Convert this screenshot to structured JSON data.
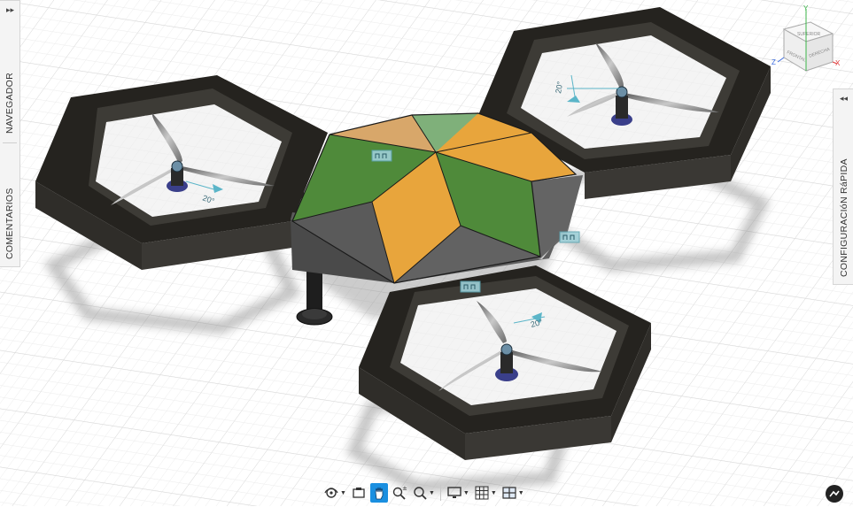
{
  "panels": {
    "navegador": "NAVEGADOR",
    "comentarios": "COMENTARIOS",
    "configuracion": "CONFIGURACIóN RáPIDA"
  },
  "viewcube": {
    "top": "SUPERIOR",
    "front": "FRONTAL",
    "right": "DERECHA",
    "axis_x": "X",
    "axis_y": "Y",
    "axis_z": "Z"
  },
  "dimensions": {
    "arm_right": "20°",
    "arm_left": "20°",
    "arm_front": "20°"
  },
  "toolbar": {
    "orbit_icon": "orbit-icon",
    "look_icon": "look-at-icon",
    "pan_icon": "pan-icon",
    "zoom_icon": "zoom-icon",
    "fit_icon": "fit-icon",
    "display_icon": "display-settings-icon",
    "grid_icon": "grid-icon",
    "viewports_icon": "viewports-icon"
  },
  "colors": {
    "frame": "#2e2c28",
    "green": "#4f8a3a",
    "green_light": "#7fb07a",
    "orange": "#e8a53c",
    "orange_light": "#d8a76a",
    "hub_gray": "#555555",
    "accent": "#1a8fe0"
  }
}
